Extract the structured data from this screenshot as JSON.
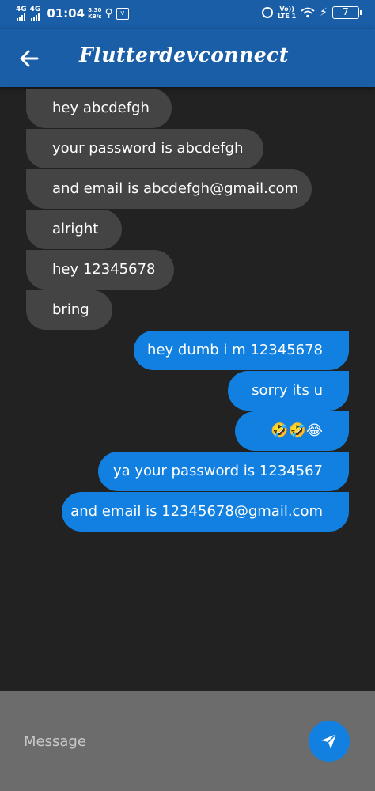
{
  "status_bar": {
    "sim1": "4G",
    "sim2": "4G",
    "time": "01:04",
    "speed_value": "8.30",
    "speed_unit": "KB/s",
    "volte_top": "Vo))",
    "volte_bottom": "LTE 1",
    "battery": "7"
  },
  "app_bar": {
    "title": "Flutterdevconnect",
    "back_icon": "arrow-left-icon"
  },
  "messages": [
    {
      "sender": "other",
      "text": "hey abcdefgh"
    },
    {
      "sender": "other",
      "text": "your password is abcdefgh"
    },
    {
      "sender": "other",
      "text": "and email is abcdefgh@gmail.com"
    },
    {
      "sender": "other",
      "text": "alright"
    },
    {
      "sender": "other",
      "text": "hey 12345678"
    },
    {
      "sender": "other",
      "text": "bring"
    },
    {
      "sender": "me",
      "text": "hey dumb i m 12345678"
    },
    {
      "sender": "me",
      "text": "sorry its u"
    },
    {
      "sender": "me",
      "text": "🤣🤣😂"
    },
    {
      "sender": "me",
      "text": "ya your password is 1234567"
    },
    {
      "sender": "me",
      "text": "and email is 12345678@gmail.com"
    }
  ],
  "composer": {
    "placeholder": "Message",
    "value": "",
    "send_icon": "send-icon"
  },
  "colors": {
    "app_bar": "#1a5ea8",
    "background": "#222222",
    "received_bubble": "#444444",
    "sent_bubble": "#1180e0",
    "composer_bg": "#6c6c6c"
  }
}
